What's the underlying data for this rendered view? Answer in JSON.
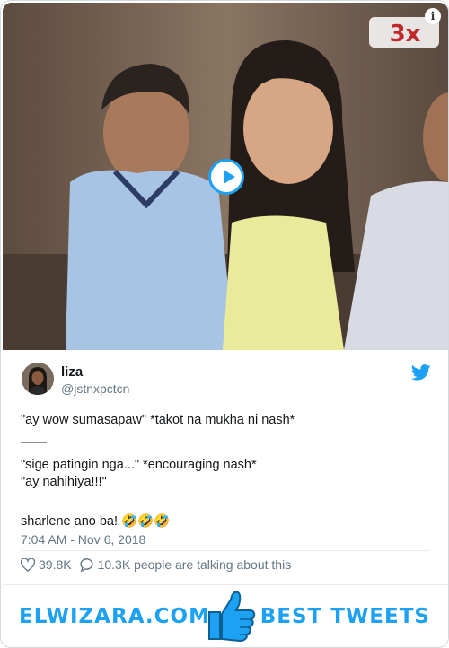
{
  "video": {
    "play_icon": "play-icon",
    "info_icon": "info-icon",
    "info_glyph": "i",
    "watermark_text": "3x"
  },
  "tweet": {
    "author_name": "liza",
    "author_handle": "@jstnxpctcn",
    "brand_icon": "twitter-bird-icon",
    "lines": [
      "\"ay wow sumasapaw\" *takot na mukha ni nash*",
      "——",
      "\"sige patingin nga...\" *encouraging nash*",
      "\"ay nahihiya!!!\"",
      "",
      "sharlene ano ba! 🤣🤣🤣"
    ],
    "timestamp": "7:04 AM - Nov 6, 2018",
    "likes": "39.8K",
    "replies_text": "10.3K people are talking about this"
  },
  "footer": {
    "left_label": "ELWIZARA.COM",
    "right_label": "BEST TWEETS",
    "center_icon": "thumbs-up-icon"
  },
  "colors": {
    "accent": "#1da1f2",
    "text": "#14171a",
    "muted": "#657786"
  }
}
